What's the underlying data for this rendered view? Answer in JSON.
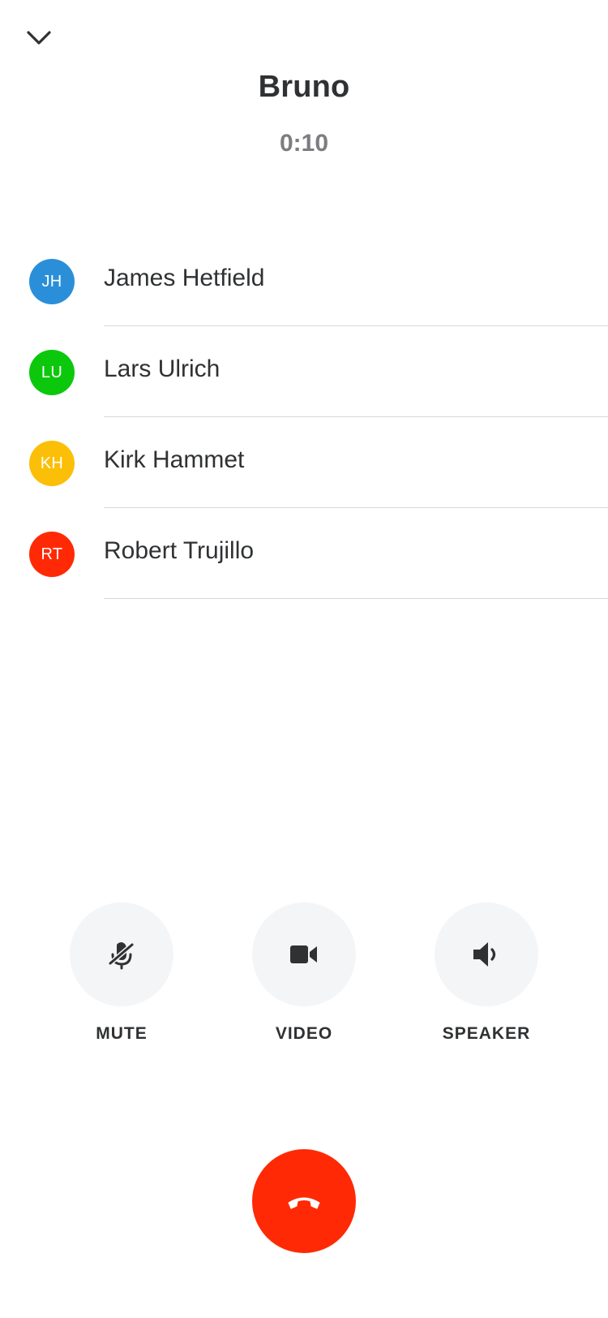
{
  "call": {
    "title": "Bruno",
    "duration": "0:10"
  },
  "icons": {
    "collapse": "chevron-down-icon",
    "mute": "microphone-off-icon",
    "video": "video-camera-icon",
    "speaker": "speaker-icon",
    "end_call": "phone-hangup-icon"
  },
  "participants": [
    {
      "initials": "JH",
      "name": "James Hetfield",
      "color": "#2a8fd8"
    },
    {
      "initials": "LU",
      "name": "Lars Ulrich",
      "color": "#0cc80c"
    },
    {
      "initials": "KH",
      "name": "Kirk Hammet",
      "color": "#fcbf08"
    },
    {
      "initials": "RT",
      "name": "Robert Trujillo",
      "color": "#ff2a05"
    }
  ],
  "controls": {
    "mute_label": "MUTE",
    "video_label": "VIDEO",
    "speaker_label": "SPEAKER"
  },
  "colors": {
    "end_call": "#ff2a05",
    "control_background": "#f4f5f7"
  }
}
